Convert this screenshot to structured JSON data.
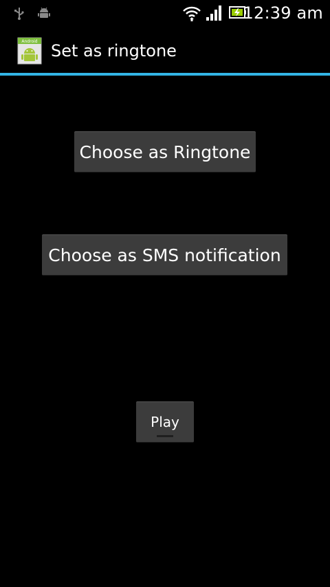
{
  "status_bar": {
    "time": "12:39 am",
    "icons": [
      "usb-icon",
      "android-debug-icon",
      "wifi-icon",
      "signal-icon",
      "battery-charging-icon"
    ]
  },
  "action_bar": {
    "app_icon": "android-app-icon",
    "app_icon_text": "Android",
    "title": "Set as ringtone",
    "accent_color": "#33b5e5"
  },
  "main": {
    "ringtone_button_label": "Choose as Ringtone",
    "sms_button_label": "Choose as SMS notification",
    "play_button_label": "Play"
  }
}
